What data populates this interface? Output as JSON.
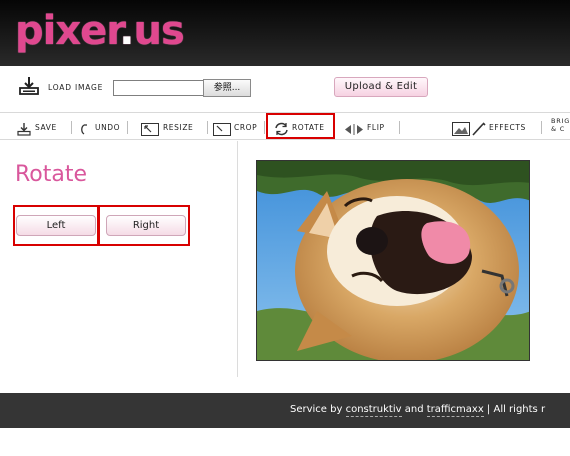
{
  "brand": {
    "name_main": "pixer",
    "name_dot": ".",
    "name_tld": "us"
  },
  "loadbar": {
    "load_label": "LOAD IMAGE",
    "file_value": "",
    "browse_label": "参照...",
    "upload_label": "Upload & Edit"
  },
  "toolbar": {
    "save": "SAVE",
    "undo": "UNDO",
    "resize": "RESIZE",
    "crop": "CROP",
    "rotate": "ROTATE",
    "flip": "FLIP",
    "effects": "EFFECTS",
    "brightness_line1": "BRIG",
    "brightness_line2": "& C"
  },
  "panel": {
    "title": "Rotate",
    "left_label": "Left",
    "right_label": "Right"
  },
  "footer": {
    "prefix": "Service by ",
    "link1": "construktiv",
    "middle": " and ",
    "link2": "trafficmaxx",
    "suffix": " | All rights r"
  },
  "colors": {
    "accent": "#d9579c",
    "highlight": "#d80000",
    "footer_bg": "#353535"
  }
}
